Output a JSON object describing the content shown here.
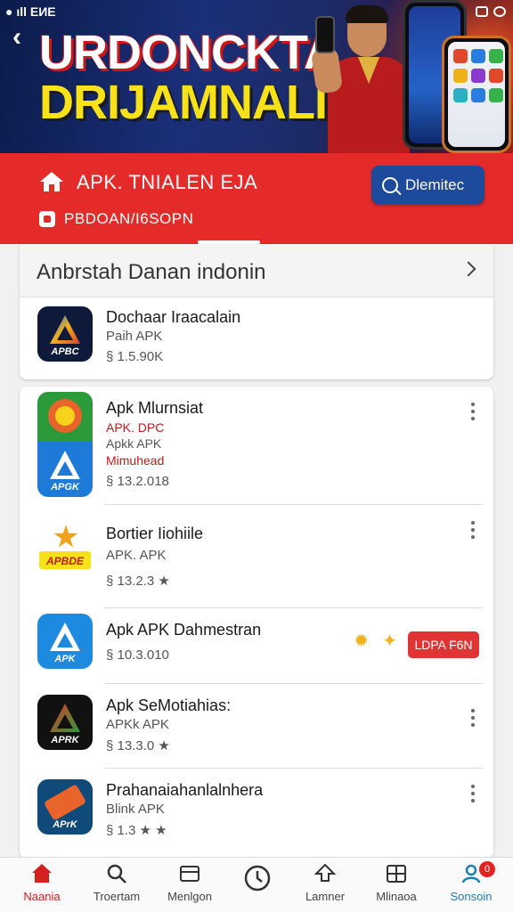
{
  "status_bar": {
    "left_text": "● ıll ЕИЕ"
  },
  "banner": {
    "title_line1": "URDONCKTA",
    "title_line2": "DRIJAMNALI"
  },
  "header": {
    "store_name": "APK. TNIALEN EJA",
    "store_subtitle": "PBDOAN/I6SOPN",
    "download_button": "Dlemitec"
  },
  "featured": {
    "section_title": "Anbrstah Danan indonin",
    "app": {
      "name": "Dochaar Iraacalain",
      "type": "Paih APK",
      "meta": "§ 1.5.90K",
      "icon_label": "APBC"
    }
  },
  "apps": [
    {
      "name": "Apk Mlurnsiat",
      "lines": [
        "APK. DPC",
        "Apkk APK",
        "Mimuhead"
      ],
      "meta": "§ 13.2.018",
      "icon_label": "APGK"
    },
    {
      "name": "Bortier Iiohiile",
      "lines": [
        "APK. APK"
      ],
      "meta": "§ 13.2.3 ★",
      "icon_label": "APBDE"
    },
    {
      "name": "Apk APK Dahmestran",
      "lines": [],
      "meta": "§ 10.3.010",
      "icon_label": "APK",
      "action": "LDPA F6N"
    },
    {
      "name": "Apk SeMotiahias:",
      "lines": [
        "APKk APK"
      ],
      "meta": "§ 13.3.0 ★",
      "icon_label": "APRK"
    },
    {
      "name": "Prahanaiahanlalnhera",
      "lines": [
        "Blink APK"
      ],
      "meta": "§ 1.3 ★ ★",
      "icon_label": "APrK"
    }
  ],
  "bottom_nav": [
    {
      "label": "Naania",
      "icon": "home-icon"
    },
    {
      "label": "Troertam",
      "icon": "search-icon"
    },
    {
      "label": "Menlgon",
      "icon": "window-icon"
    },
    {
      "label": "",
      "icon": "clock-icon"
    },
    {
      "label": "Lamner",
      "icon": "upload-icon"
    },
    {
      "label": "Mlinaoa",
      "icon": "grid-icon"
    },
    {
      "label": "Sonsoin",
      "icon": "profile-icon",
      "badge": "0"
    }
  ],
  "colors": {
    "brand_red": "#e52a2a",
    "button_blue": "#1d4a9b",
    "title_yellow": "#f7e21a"
  }
}
